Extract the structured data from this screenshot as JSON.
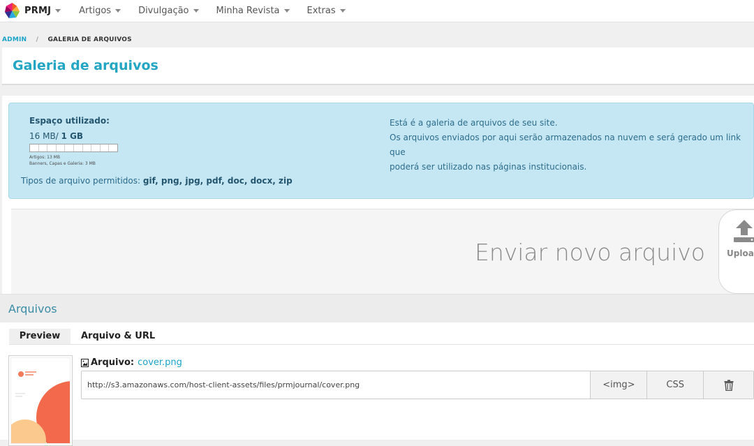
{
  "nav": {
    "brand": "PRMJ",
    "items": [
      {
        "label": "Artigos"
      },
      {
        "label": "Divulgação"
      },
      {
        "label": "Minha Revista"
      },
      {
        "label": "Extras"
      }
    ]
  },
  "breadcrumb": {
    "root": "ADMIN",
    "separator": "/",
    "current": "GALERIA DE ARQUIVOS"
  },
  "page": {
    "title": "Galeria de arquivos"
  },
  "info": {
    "space_label": "Espaço utilizado:",
    "used": "16 MB/",
    "total": "1 GB",
    "usage_fraction": 0.016,
    "note_articles": "Artigos: 13 MB",
    "note_banners": "Banners, Capas e Galeria: 3 MB",
    "types_label": "Tipos de arquivo permitidos:",
    "types_value": "gif, png, jpg, pdf, doc, docx, zip",
    "desc_line1": "Está é a galeria de arquivos de seu site.",
    "desc_line2": "Os arquivos enviados por aqui serão armazenados na nuvem e será gerado um link que",
    "desc_line3": "poderá ser utilizado nas páginas institucionais."
  },
  "upload": {
    "text": "Enviar novo arquivo",
    "button_label": "Uploa"
  },
  "files": {
    "title": "Arquivos",
    "col_preview": "Preview",
    "col_file": "Arquivo & URL",
    "rows": [
      {
        "label": "Arquivo:",
        "name": "cover.png",
        "url": "http://s3.amazonaws.com/host-client-assets/files/prmjournal/cover.png",
        "btn_img": "<img>",
        "btn_css": "CSS"
      }
    ]
  },
  "colors": {
    "accent": "#22a6c3",
    "info_bg": "#c5e7f3",
    "link": "#1aa3c8"
  }
}
